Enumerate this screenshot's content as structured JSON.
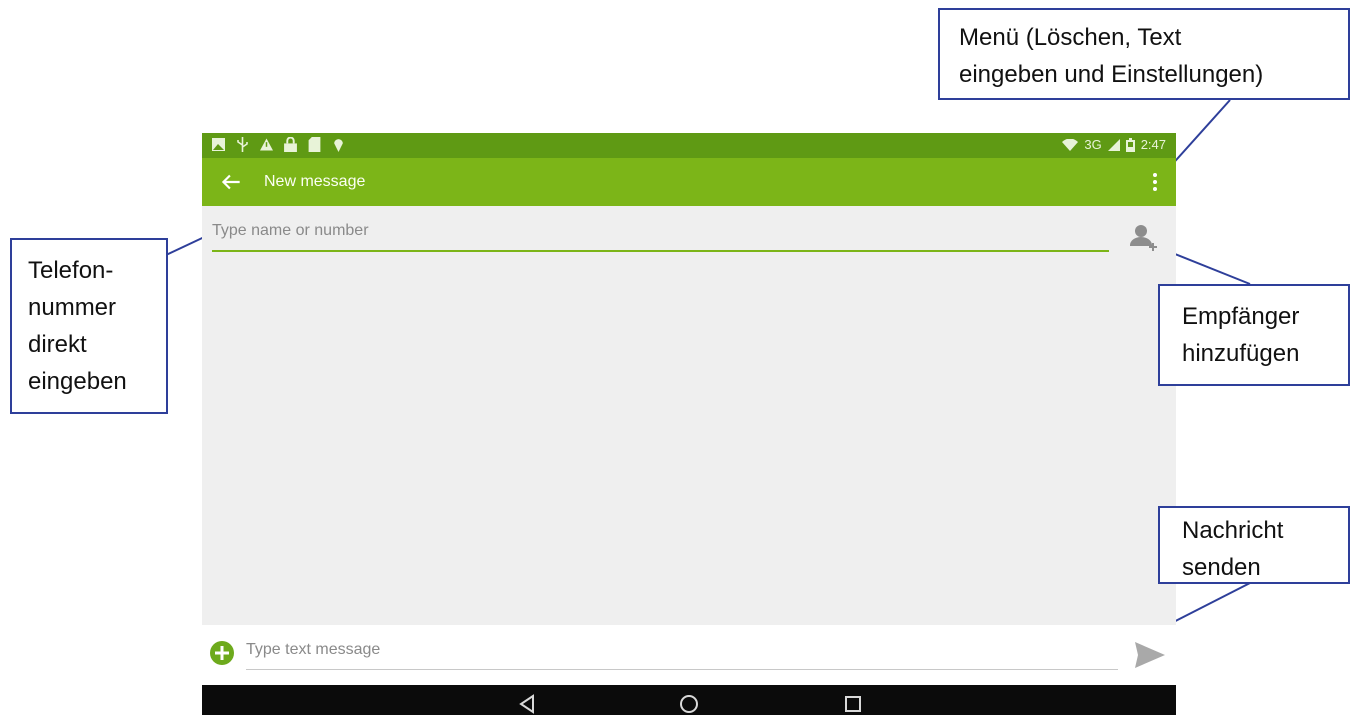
{
  "statusbar": {
    "left_icons": [
      "photo-icon",
      "usb-icon",
      "warning-icon",
      "lock-icon",
      "sd-card-icon",
      "location-icon"
    ],
    "network": "3G",
    "time": "2:47"
  },
  "appbar": {
    "title": "New message"
  },
  "recipient": {
    "placeholder": "Type name or number"
  },
  "compose": {
    "placeholder": "Type text message"
  },
  "colors": {
    "appbar": "#7cb518",
    "statusbar": "#5f9a14",
    "callout_border": "#2e3f9a"
  },
  "callouts": {
    "menu": [
      "Menü (Löschen, Text",
      "eingeben und Einstellungen)"
    ],
    "phone": [
      "Telefon-",
      "nummer",
      "direkt",
      "eingeben"
    ],
    "recipient": [
      "Empfänger",
      "hinzufügen"
    ],
    "send": [
      "Nachricht",
      "senden"
    ]
  }
}
